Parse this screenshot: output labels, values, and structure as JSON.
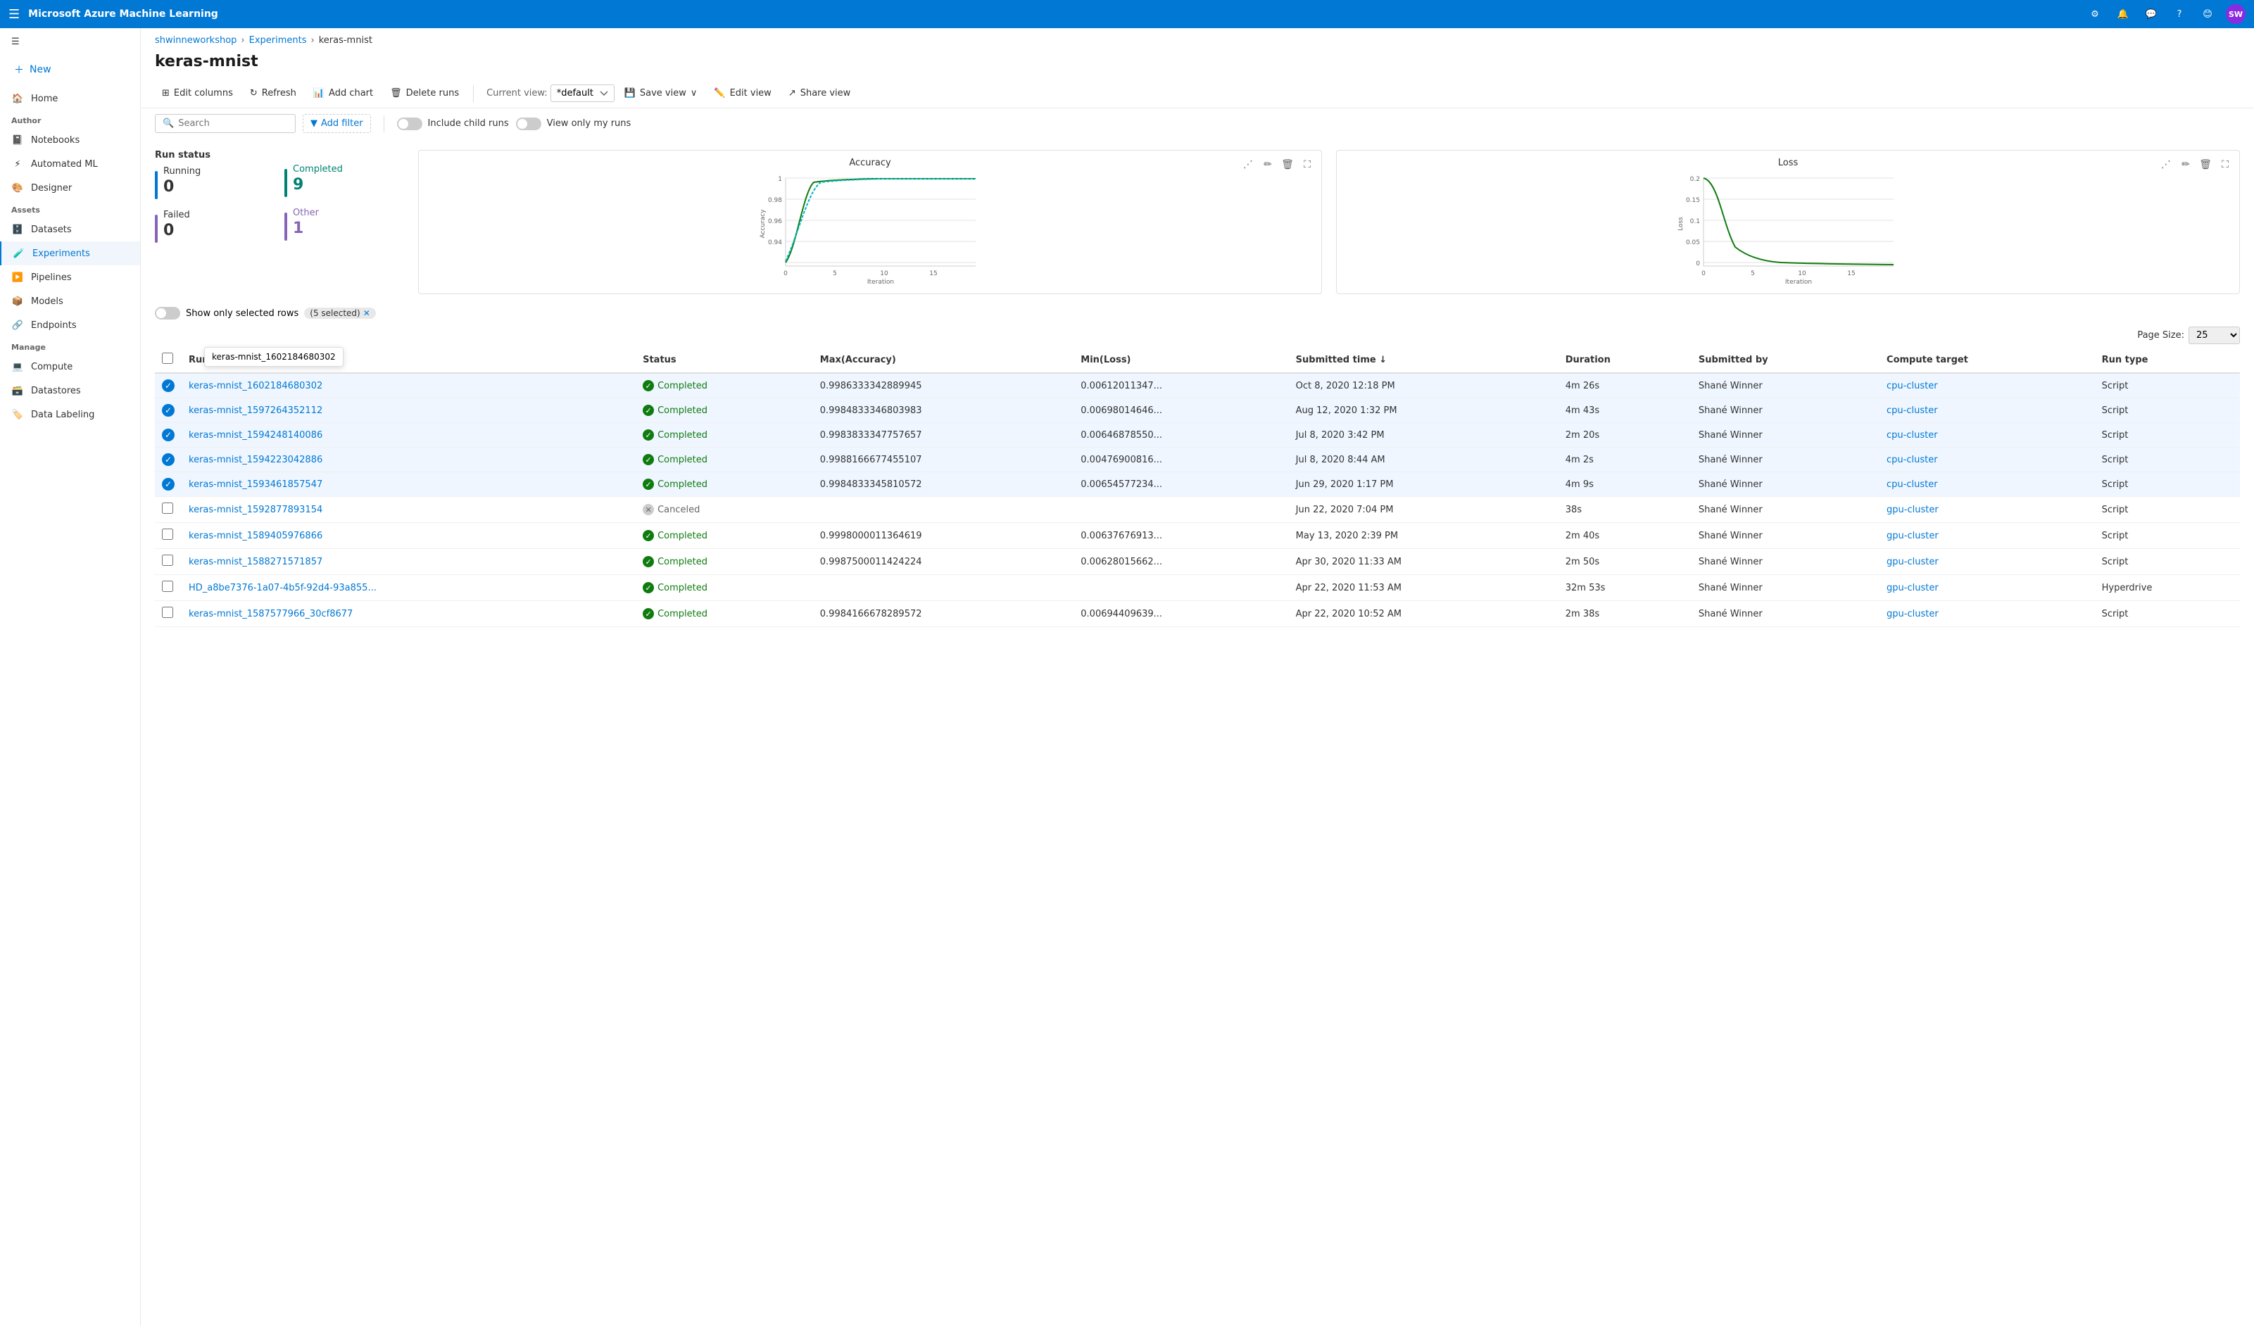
{
  "topbar": {
    "title": "Microsoft Azure Machine Learning",
    "avatar_initials": "SW"
  },
  "breadcrumb": {
    "workspace": "shwinneworkshop",
    "section": "Experiments",
    "current": "keras-mnist"
  },
  "page": {
    "title": "keras-mnist"
  },
  "toolbar": {
    "edit_columns": "Edit columns",
    "refresh": "Refresh",
    "add_chart": "Add chart",
    "delete_runs": "Delete runs",
    "current_view_label": "Current view:",
    "current_view_value": "*default",
    "save_view": "Save view",
    "edit_view": "Edit view",
    "share_view": "Share view"
  },
  "filterbar": {
    "search_placeholder": "Search",
    "add_filter": "Add filter",
    "include_child_runs": "Include child runs",
    "view_only_my_runs": "View only my runs"
  },
  "stats": {
    "title": "Run status",
    "running_label": "Running",
    "running_value": "0",
    "failed_label": "Failed",
    "failed_value": "0",
    "completed_label": "Completed",
    "completed_value": "9",
    "other_label": "Other",
    "other_value": "1"
  },
  "charts": {
    "accuracy": {
      "title": "Accuracy",
      "x_label": "Iteration",
      "y_label": "Accuracy",
      "y_min": 0.93,
      "y_max": 1.0
    },
    "loss": {
      "title": "Loss",
      "x_label": "Iteration",
      "y_label": "Loss",
      "y_min": 0,
      "y_max": 0.2
    }
  },
  "selected_rows": {
    "label": "Show only selected rows",
    "count": "(5 selected)"
  },
  "table": {
    "page_size_label": "Page Size:",
    "page_size_value": "25",
    "columns": [
      "Run ID",
      "Status",
      "Max(Accuracy)",
      "Min(Loss)",
      "Submitted time",
      "Duration",
      "Submitted by",
      "Compute target",
      "Run type"
    ],
    "rows": [
      {
        "id": "keras-mnist_1602184680302",
        "status": "Completed",
        "max_accuracy": "0.9986333342889945",
        "min_loss": "0.00612011347...",
        "submitted_time": "Oct 8, 2020 12:18 PM",
        "duration": "4m 26s",
        "submitted_by": "Shané Winner",
        "compute_target": "cpu-cluster",
        "run_type": "Script",
        "selected": true
      },
      {
        "id": "keras-mnist_1597264352112",
        "status": "Completed",
        "max_accuracy": "0.9984833346803983",
        "min_loss": "0.00698014646...",
        "submitted_time": "Aug 12, 2020 1:32 PM",
        "duration": "4m 43s",
        "submitted_by": "Shané Winner",
        "compute_target": "cpu-cluster",
        "run_type": "Script",
        "selected": true
      },
      {
        "id": "keras-mnist_1594248140086",
        "status": "Completed",
        "max_accuracy": "0.9983833347757657",
        "min_loss": "0.00646878550...",
        "submitted_time": "Jul 8, 2020 3:42 PM",
        "duration": "2m 20s",
        "submitted_by": "Shané Winner",
        "compute_target": "cpu-cluster",
        "run_type": "Script",
        "selected": true
      },
      {
        "id": "keras-mnist_1594223042886",
        "status": "Completed",
        "max_accuracy": "0.9988166677455107",
        "min_loss": "0.00476900816...",
        "submitted_time": "Jul 8, 2020 8:44 AM",
        "duration": "4m 2s",
        "submitted_by": "Shané Winner",
        "compute_target": "cpu-cluster",
        "run_type": "Script",
        "selected": true
      },
      {
        "id": "keras-mnist_1593461857547",
        "status": "Completed",
        "max_accuracy": "0.9984833345810572",
        "min_loss": "0.00654577234...",
        "submitted_time": "Jun 29, 2020 1:17 PM",
        "duration": "4m 9s",
        "submitted_by": "Shané Winner",
        "compute_target": "cpu-cluster",
        "run_type": "Script",
        "selected": true
      },
      {
        "id": "keras-mnist_1592877893154",
        "status": "Canceled",
        "max_accuracy": "",
        "min_loss": "",
        "submitted_time": "Jun 22, 2020 7:04 PM",
        "duration": "38s",
        "submitted_by": "Shané Winner",
        "compute_target": "gpu-cluster",
        "run_type": "Script",
        "selected": false
      },
      {
        "id": "keras-mnist_1589405976866",
        "status": "Completed",
        "max_accuracy": "0.9998000011364619",
        "min_loss": "0.00637676913...",
        "submitted_time": "May 13, 2020 2:39 PM",
        "duration": "2m 40s",
        "submitted_by": "Shané Winner",
        "compute_target": "gpu-cluster",
        "run_type": "Script",
        "selected": false
      },
      {
        "id": "keras-mnist_1588271571857",
        "status": "Completed",
        "max_accuracy": "0.9987500011424224",
        "min_loss": "0.00628015662...",
        "submitted_time": "Apr 30, 2020 11:33 AM",
        "duration": "2m 50s",
        "submitted_by": "Shané Winner",
        "compute_target": "gpu-cluster",
        "run_type": "Script",
        "selected": false
      },
      {
        "id": "HD_a8be7376-1a07-4b5f-92d4-93a855...",
        "status": "Completed",
        "max_accuracy": "",
        "min_loss": "",
        "submitted_time": "Apr 22, 2020 11:53 AM",
        "duration": "32m 53s",
        "submitted_by": "Shané Winner",
        "compute_target": "gpu-cluster",
        "run_type": "Hyperdrive",
        "selected": false
      },
      {
        "id": "keras-mnist_1587577966_30cf8677",
        "status": "Completed",
        "max_accuracy": "0.9984166678289572",
        "min_loss": "0.00694409639...",
        "submitted_time": "Apr 22, 2020 10:52 AM",
        "duration": "2m 38s",
        "submitted_by": "Shané Winner",
        "compute_target": "gpu-cluster",
        "run_type": "Script",
        "selected": false
      }
    ]
  },
  "tooltip": {
    "run_id": "keras-mnist_1602184680302"
  },
  "sidebar": {
    "items": [
      {
        "id": "home",
        "label": "Home",
        "icon": "🏠"
      },
      {
        "id": "notebooks",
        "label": "Notebooks",
        "icon": "📓"
      },
      {
        "id": "automated-ml",
        "label": "Automated ML",
        "icon": "⚡"
      },
      {
        "id": "designer",
        "label": "Designer",
        "icon": "🎨"
      },
      {
        "id": "datasets",
        "label": "Datasets",
        "icon": "🗄️"
      },
      {
        "id": "experiments",
        "label": "Experiments",
        "icon": "🧪"
      },
      {
        "id": "pipelines",
        "label": "Pipelines",
        "icon": "▶️"
      },
      {
        "id": "models",
        "label": "Models",
        "icon": "📦"
      },
      {
        "id": "endpoints",
        "label": "Endpoints",
        "icon": "🔗"
      },
      {
        "id": "compute",
        "label": "Compute",
        "icon": "💻"
      },
      {
        "id": "datastores",
        "label": "Datastores",
        "icon": "🗃️"
      },
      {
        "id": "data-labeling",
        "label": "Data Labeling",
        "icon": "🏷️"
      }
    ],
    "new_label": "New",
    "author_label": "Author",
    "assets_label": "Assets",
    "manage_label": "Manage"
  }
}
